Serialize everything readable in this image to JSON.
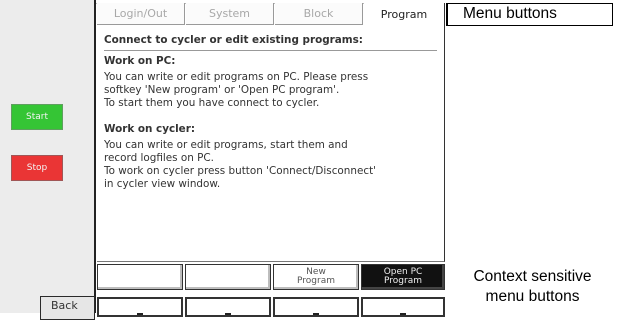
{
  "tabs": [
    {
      "label": "Login/Out"
    },
    {
      "label": "System"
    },
    {
      "label": "Block"
    },
    {
      "label": "Program",
      "active": true
    }
  ],
  "side_buttons": {
    "start": "Start",
    "stop": "Stop",
    "back": "Back"
  },
  "content": {
    "title": "Connect to cycler or edit existing programs:",
    "pc_heading": "Work on PC:",
    "pc_text": "You can write or edit programs on PC. Please press\nsoftkey 'New program' or 'Open PC program'.\nTo start them you have connect to cycler.",
    "cycler_heading": "Work on cycler:",
    "cycler_text": "You can write or edit programs, start them and\nrecord logfiles on PC.\nTo work on cycler press button 'Connect/Disconnect'\nin cycler view window."
  },
  "softkeys": [
    {
      "label": ""
    },
    {
      "label": ""
    },
    {
      "label": "New\nProgram"
    },
    {
      "label": "Open PC\nProgram",
      "active": true
    }
  ],
  "annotations": {
    "menu_buttons": "Menu buttons",
    "context_buttons": "Context sensitive\nmenu buttons"
  },
  "colors": {
    "start": "#35c535",
    "stop": "#ea3535",
    "active_softkey": "#111111"
  }
}
